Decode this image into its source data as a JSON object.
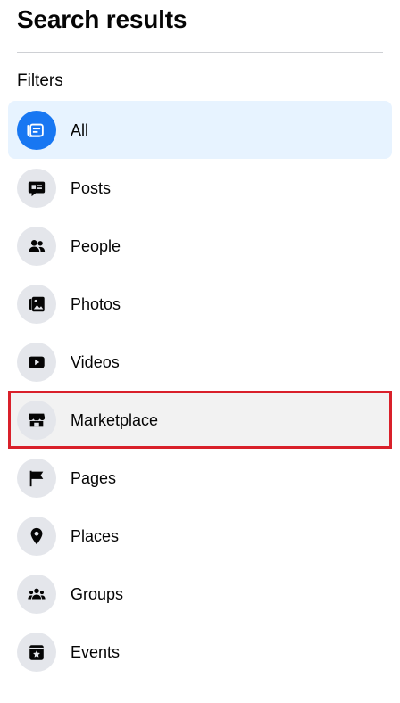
{
  "header": {
    "title": "Search results",
    "filters_label": "Filters"
  },
  "filters": [
    {
      "label": "All",
      "icon": "all-icon",
      "state": "selected"
    },
    {
      "label": "Posts",
      "icon": "posts-icon",
      "state": "normal"
    },
    {
      "label": "People",
      "icon": "people-icon",
      "state": "normal"
    },
    {
      "label": "Photos",
      "icon": "photos-icon",
      "state": "normal"
    },
    {
      "label": "Videos",
      "icon": "videos-icon",
      "state": "normal"
    },
    {
      "label": "Marketplace",
      "icon": "marketplace-icon",
      "state": "hovered-highlighted"
    },
    {
      "label": "Pages",
      "icon": "pages-icon",
      "state": "normal"
    },
    {
      "label": "Places",
      "icon": "places-icon",
      "state": "normal"
    },
    {
      "label": "Groups",
      "icon": "groups-icon",
      "state": "normal"
    },
    {
      "label": "Events",
      "icon": "events-icon",
      "state": "normal"
    }
  ],
  "colors": {
    "accent": "#1877f2",
    "selected_bg": "#e7f3ff",
    "hover_bg": "#f2f2f2",
    "highlight_border": "#d9202a",
    "icon_bg": "#e4e6eb"
  }
}
